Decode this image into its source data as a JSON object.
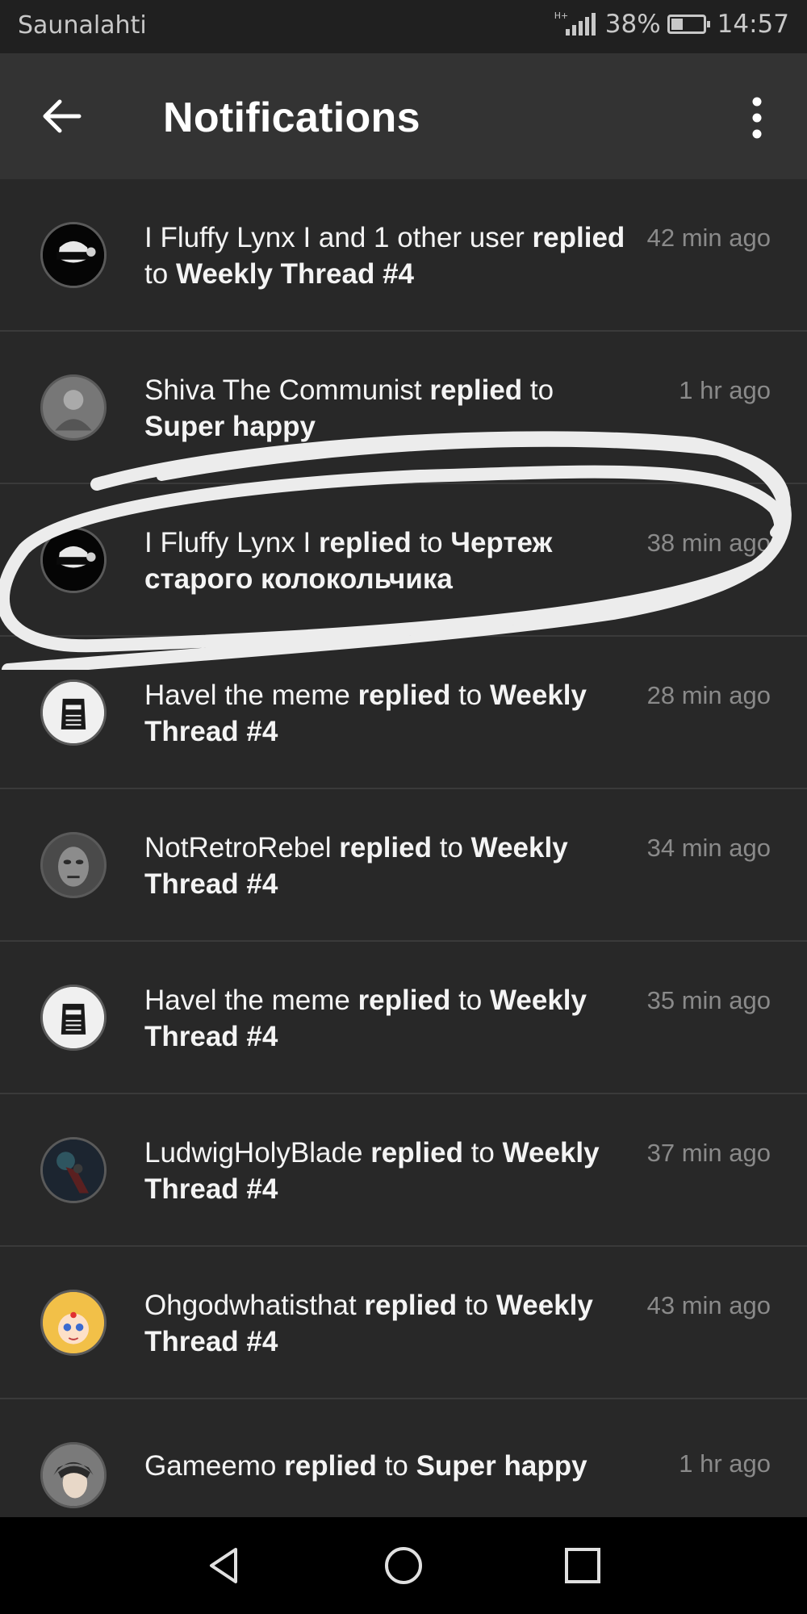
{
  "status_bar": {
    "carrier": "Saunalahti",
    "network": "H+",
    "battery_percent": "38%",
    "battery_level": 0.38,
    "time": "14:57"
  },
  "app_bar": {
    "title": "Notifications",
    "back_icon": "arrow-left-icon",
    "menu_icon": "more-vertical-icon"
  },
  "notifications": [
    {
      "user": "I Fluffy Lynx I and 1 other user",
      "action": "replied",
      "prep": "to",
      "target": "Weekly Thread #4",
      "time": "42 min ago",
      "avatar": "masked-face-avatar"
    },
    {
      "user": "Shiva The Communist",
      "action": "replied",
      "prep": "to",
      "target": "Super happy",
      "time": "1 hr ago",
      "avatar": "portrait-avatar"
    },
    {
      "user": "I Fluffy Lynx I",
      "action": "replied",
      "prep": "to",
      "target": "Чертеж старого колокольчика",
      "time": "38 min ago",
      "avatar": "masked-face-avatar"
    },
    {
      "user": "Havel the meme",
      "action": "replied",
      "prep": "to",
      "target": "Weekly Thread #4",
      "time": "28 min ago",
      "avatar": "knight-helmet-avatar"
    },
    {
      "user": "NotRetroRebel",
      "action": "replied",
      "prep": "to",
      "target": "Weekly Thread #4",
      "time": "34 min ago",
      "avatar": "stone-face-avatar"
    },
    {
      "user": "Havel the meme",
      "action": "replied",
      "prep": "to",
      "target": "Weekly Thread #4",
      "time": "35 min ago",
      "avatar": "knight-helmet-avatar"
    },
    {
      "user": "LudwigHolyBlade",
      "action": "replied",
      "prep": "to",
      "target": "Weekly Thread #4",
      "time": "37 min ago",
      "avatar": "dark-hunter-avatar"
    },
    {
      "user": "Ohgodwhatisthat",
      "action": "replied",
      "prep": "to",
      "target": "Weekly Thread #4",
      "time": "43 min ago",
      "avatar": "anime-girl-avatar"
    },
    {
      "user": "Gameemo",
      "action": "replied",
      "prep": "to",
      "target": "Super happy",
      "time": "1 hr ago",
      "avatar": "anime-boy-avatar"
    }
  ],
  "nav_bar": {
    "back_icon": "triangle-back-icon",
    "home_icon": "circle-home-icon",
    "recents_icon": "square-recents-icon"
  },
  "colors": {
    "background": "#282828",
    "app_bar": "#333333",
    "status_bar": "#202020",
    "text": "#f4f4f4",
    "timestamp": "#8a8a8a",
    "annotation": "#ececec"
  }
}
